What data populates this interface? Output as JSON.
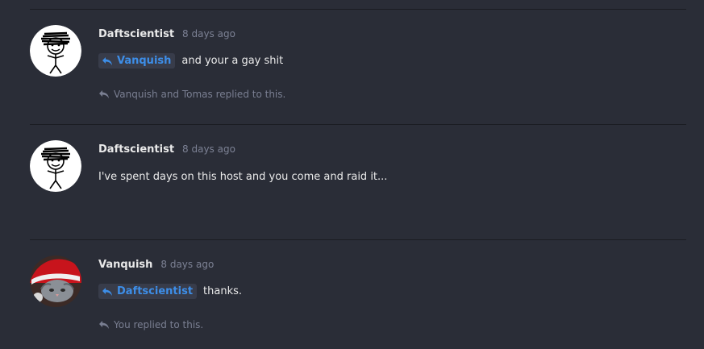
{
  "comments": [
    {
      "username": "Daftscientist",
      "time": "8 days ago",
      "mention": "Vanquish",
      "text": "and your a gay shit",
      "replied": "Vanquish and Tomas replied to this.",
      "avatar": "stick-figure-avatar"
    },
    {
      "username": "Daftscientist",
      "time": "8 days ago",
      "text": "I've spent days on this host and you come and raid it...",
      "avatar": "stick-figure-avatar"
    },
    {
      "username": "Vanquish",
      "time": "8 days ago",
      "mention": "Daftscientist",
      "text": "thanks.",
      "replied": "You replied to this.",
      "avatar": "santa-cat-avatar"
    }
  ],
  "colors": {
    "background": "#2a2d37",
    "mention_bg": "#383c4a",
    "mention_text": "#3d8ee8",
    "muted": "#7a7f92"
  }
}
